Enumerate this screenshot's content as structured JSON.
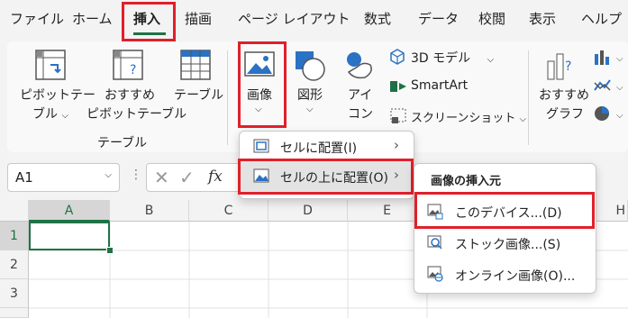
{
  "tabs": [
    "ファイル",
    "ホーム",
    "挿入",
    "描画",
    "ページ レイアウト",
    "数式",
    "データ",
    "校閲",
    "表示",
    "ヘルプ"
  ],
  "ribbon": {
    "pivot_table_1": "ピボットテー",
    "pivot_table_2": "ブル",
    "recommended_pivot_1": "おすすめ",
    "recommended_pivot_2": "ピボットテーブル",
    "table": "テーブル",
    "tables_group": "テーブル",
    "image": "画像",
    "shapes": "図形",
    "icons_1": "アイ",
    "icons_2": "コン",
    "model3d": "3D モデル",
    "smartart": "SmartArt",
    "screenshot": "スクリーンショット",
    "recommended_chart_1": "おすすめ",
    "recommended_chart_2": "グラフ"
  },
  "formula_bar": {
    "name_box": "A1",
    "fx": "fx"
  },
  "grid": {
    "columns": [
      "A",
      "B",
      "C",
      "D",
      "E",
      "H"
    ],
    "rows": [
      "1",
      "2",
      "3"
    ]
  },
  "image_menu": {
    "in_cell": "セルに配置(I)",
    "over_cells": "セルの上に配置(O)"
  },
  "insert_from_menu": {
    "header": "画像の挿入元",
    "this_device": "このデバイス...(D)",
    "stock_images": "ストック画像...(S)",
    "online_images": "オンライン画像(O)..."
  },
  "colors": {
    "accent_green": "#1e7145",
    "highlight_red": "#e0202a",
    "selected_cell_border": "#217346"
  }
}
